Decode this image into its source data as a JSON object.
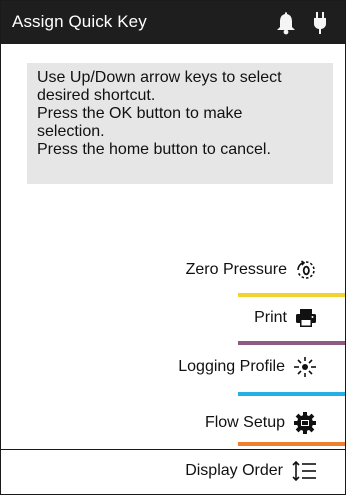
{
  "header": {
    "title": "Assign Quick Key",
    "icons": [
      "bell-icon",
      "power-plug-icon"
    ]
  },
  "instructions": {
    "lines": [
      "Use Up/Down arrow keys to select",
      "desired shortcut.",
      "Press the OK button to make",
      "selection.",
      "Press the home button to cancel."
    ]
  },
  "menu": {
    "items": [
      {
        "label": "Zero Pressure",
        "icon": "zero-pressure-icon",
        "color": "#f2d22e"
      },
      {
        "label": "Print",
        "icon": "printer-icon",
        "color": "#8e5a82"
      },
      {
        "label": "Logging Profile",
        "icon": "logging-profile-icon",
        "color": "#24b0e4"
      },
      {
        "label": "Flow Setup",
        "icon": "flow-setup-icon",
        "color": "#ef7f2e"
      },
      {
        "label": "Display Order",
        "icon": "display-order-icon",
        "color": ""
      }
    ]
  },
  "colors": {
    "titlebar": "#1e1e1e",
    "instruction_bg": "#e6e6e6"
  }
}
